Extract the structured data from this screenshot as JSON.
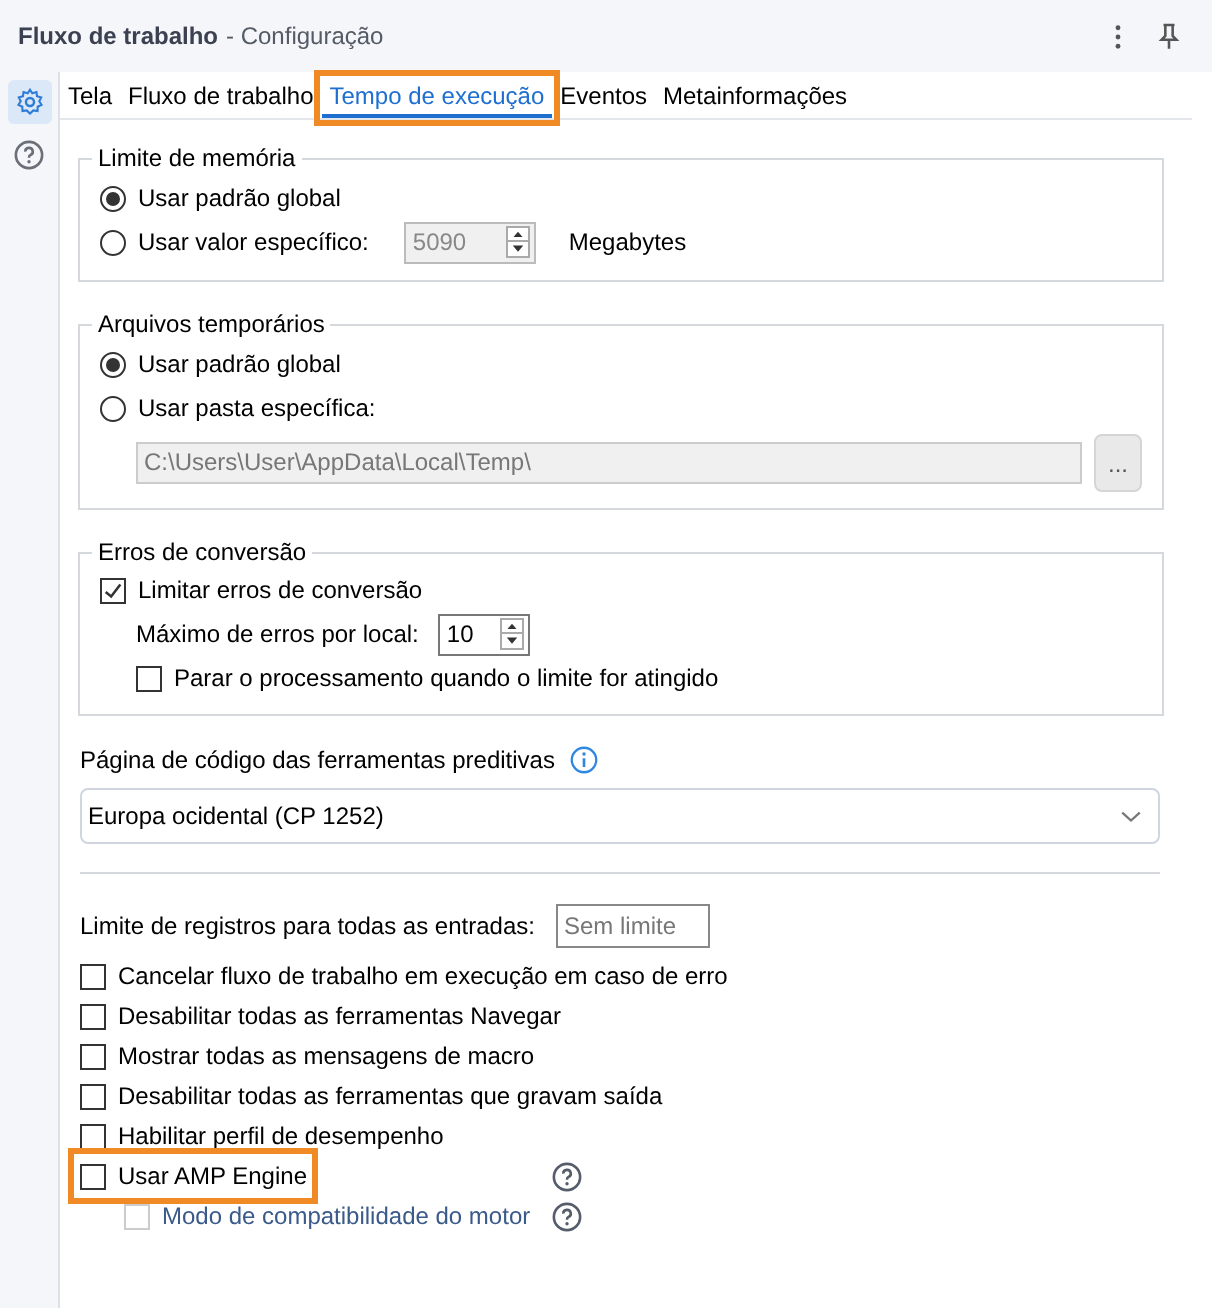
{
  "window": {
    "title": "Fluxo de trabalho",
    "subtitle": "- Configuração"
  },
  "sidebar": {
    "items": [
      {
        "kind": "settings",
        "selected": true
      },
      {
        "kind": "help",
        "selected": false
      }
    ]
  },
  "tabs": [
    {
      "label": "Tela",
      "selected": false,
      "highlighted": false
    },
    {
      "label": "Fluxo de trabalho",
      "selected": false,
      "highlighted": false
    },
    {
      "label": "Tempo de execução",
      "selected": true,
      "highlighted": true
    },
    {
      "label": "Eventos",
      "selected": false,
      "highlighted": false
    },
    {
      "label": "Metainformações",
      "selected": false,
      "highlighted": false
    }
  ],
  "memory_limit": {
    "title": "Limite de memória",
    "options": [
      {
        "label": "Usar padrão global",
        "selected": true
      },
      {
        "label": "Usar valor específico:",
        "selected": false
      }
    ],
    "value": "5090",
    "unit": "Megabytes"
  },
  "temp_files": {
    "title": "Arquivos temporários",
    "options": [
      {
        "label": "Usar padrão global",
        "selected": true
      },
      {
        "label": "Usar pasta específica:",
        "selected": false
      }
    ],
    "path": "C:\\Users\\User\\AppData\\Local\\Temp\\",
    "browse_button": "..."
  },
  "conversion_errors": {
    "title": "Erros de conversão",
    "limit": {
      "label": "Limitar erros de conversão",
      "checked": true
    },
    "max_label": "Máximo de erros por local:",
    "max_value": "10",
    "stop": {
      "label": "Parar o processamento quando o limite for atingido",
      "checked": false
    }
  },
  "code_page": {
    "label": "Página de código das ferramentas preditivas",
    "value": "Europa ocidental (CP 1252)"
  },
  "record_limit": {
    "label": "Limite de registros para todas as entradas:",
    "placeholder": "Sem limite"
  },
  "options": [
    {
      "label": "Cancelar fluxo de trabalho em execução em caso de erro",
      "checked": false,
      "highlighted": false,
      "help": false,
      "disabled": false
    },
    {
      "label": "Desabilitar todas as ferramentas Navegar",
      "checked": false,
      "highlighted": false,
      "help": false,
      "disabled": false
    },
    {
      "label": "Mostrar todas as mensagens de macro",
      "checked": false,
      "highlighted": false,
      "help": false,
      "disabled": false
    },
    {
      "label": "Desabilitar todas as ferramentas que gravam saída",
      "checked": false,
      "highlighted": false,
      "help": false,
      "disabled": false
    },
    {
      "label": "Habilitar perfil de desempenho",
      "checked": false,
      "highlighted": false,
      "help": false,
      "disabled": false
    },
    {
      "label": "Usar AMP Engine",
      "checked": false,
      "highlighted": true,
      "help": true,
      "disabled": false,
      "children": [
        {
          "label": "Modo de compatibilidade do motor",
          "checked": false,
          "highlighted": false,
          "help": true,
          "disabled": true
        }
      ]
    }
  ]
}
